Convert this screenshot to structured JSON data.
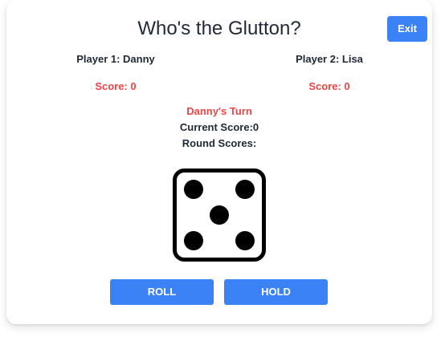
{
  "title": "Who's the Glutton?",
  "exit_label": "Exit",
  "players": [
    {
      "name_label": "Player 1: Danny",
      "score_label": "Score: 0"
    },
    {
      "name_label": "Player 2: Lisa",
      "score_label": "Score: 0"
    }
  ],
  "turn": {
    "turn_label": "Danny's Turn",
    "current_score_label": "Current Score:0",
    "round_scores_label": "Round Scores:"
  },
  "die": {
    "value": 5,
    "icon": "die-five-icon"
  },
  "actions": {
    "roll_label": "ROLL",
    "hold_label": "HOLD"
  },
  "colors": {
    "accent": "#3b82f6",
    "highlight": "#ef4444",
    "text": "#1f2937"
  }
}
